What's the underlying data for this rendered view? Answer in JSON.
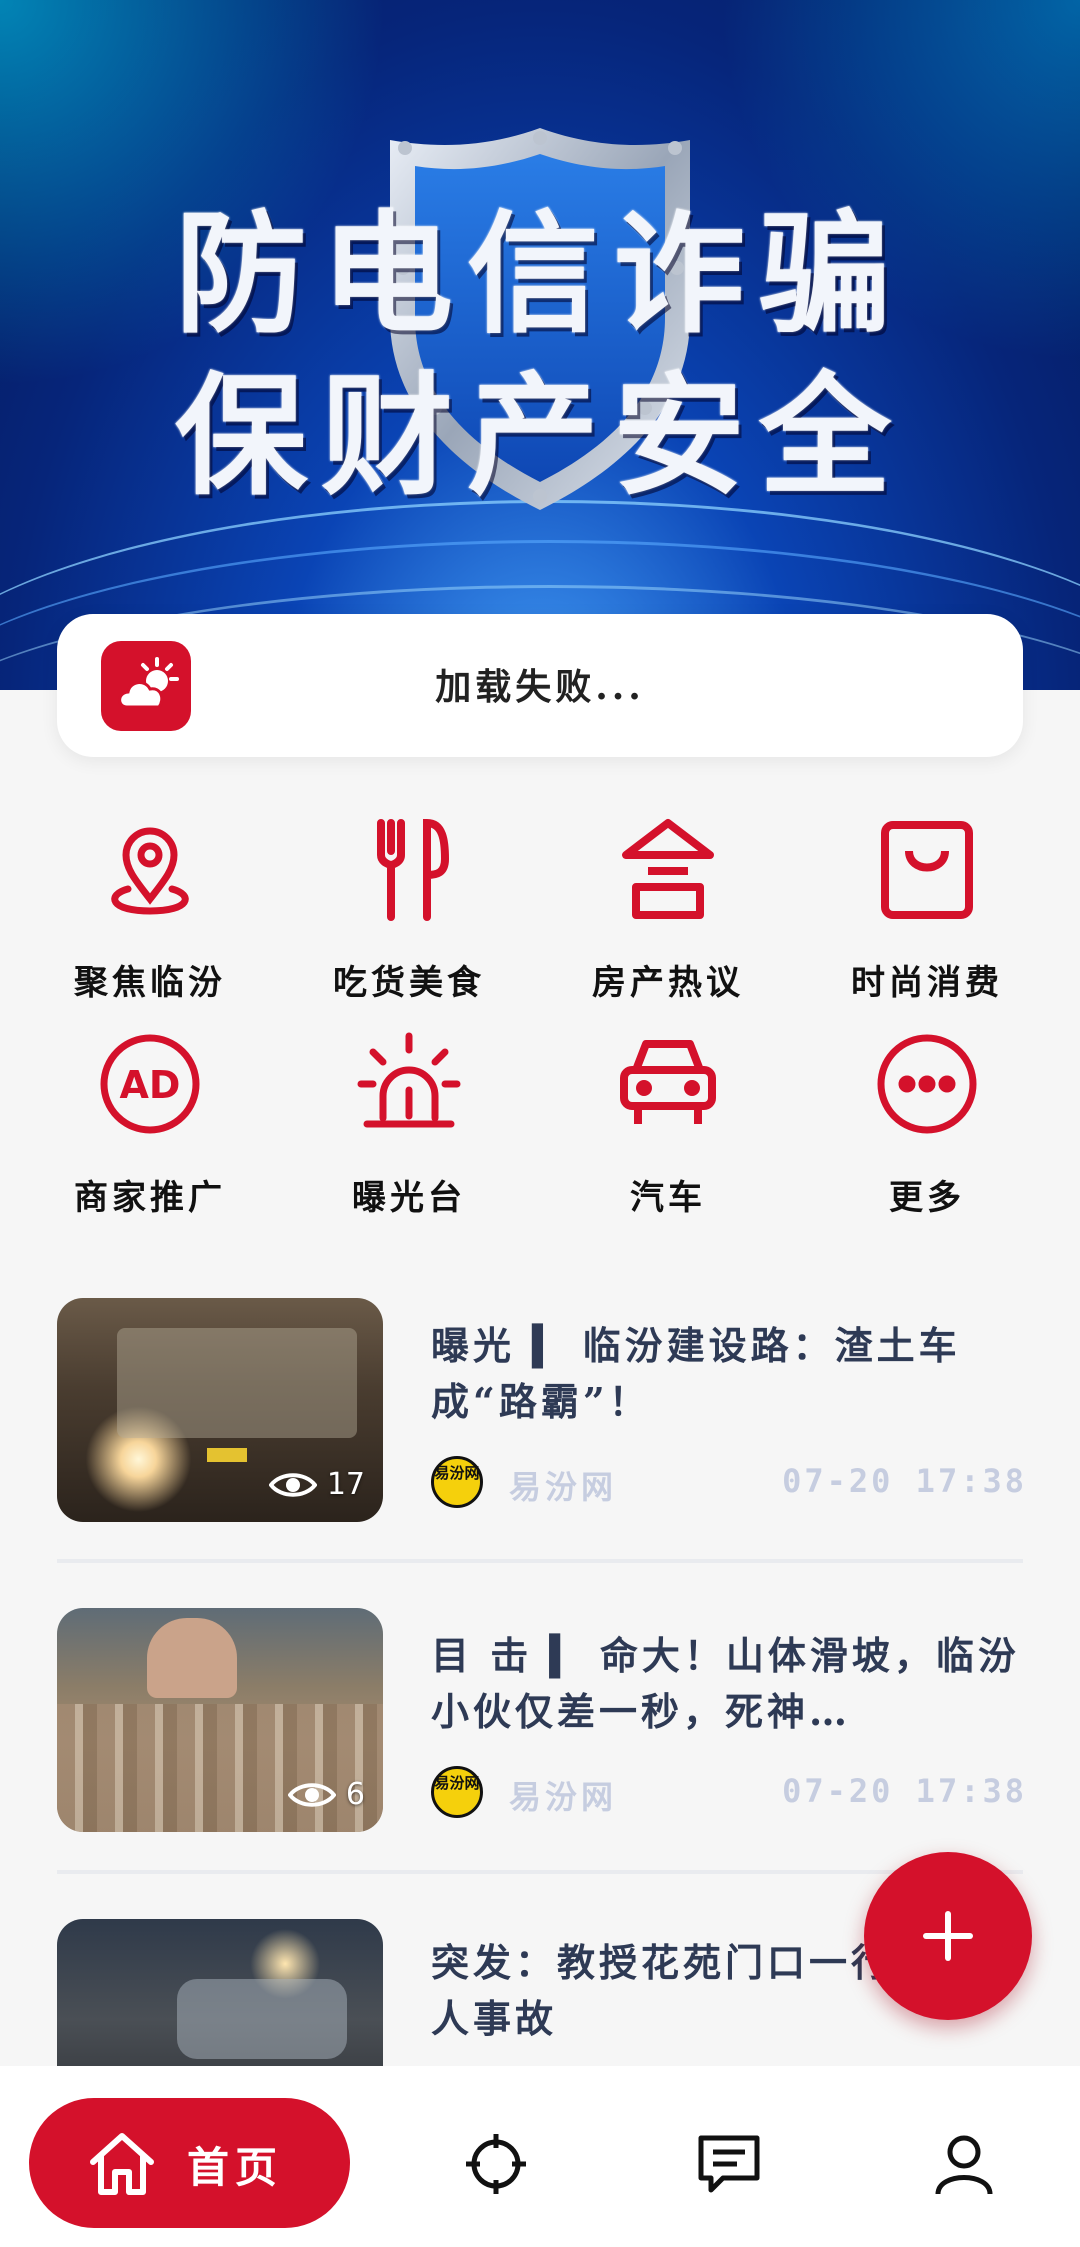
{
  "banner": {
    "line1": "防电信诈骗",
    "line2": "保财产安全"
  },
  "weather": {
    "icon": "weather-cloud-sun-icon",
    "status_text": "加载失败..."
  },
  "categories": [
    {
      "label": "聚焦临汾",
      "icon": "location-pin-icon"
    },
    {
      "label": "吃货美食",
      "icon": "fork-knife-icon"
    },
    {
      "label": "房产热议",
      "icon": "house-icon"
    },
    {
      "label": "时尚消费",
      "icon": "shopping-bag-icon"
    },
    {
      "label": "商家推广",
      "icon": "ad-icon"
    },
    {
      "label": "曝光台",
      "icon": "alarm-light-icon"
    },
    {
      "label": "汽车",
      "icon": "car-icon"
    },
    {
      "label": "更多",
      "icon": "more-icon"
    }
  ],
  "articles": [
    {
      "title": "曝光 ▍ 临汾建设路：渣土车成“路霸”！",
      "views": "17",
      "source_logo": "易汾网",
      "source": "易汾网",
      "time": "07-20 17:38"
    },
    {
      "title": "目 击 ▍ 命大！山体滑坡，临汾小伙仅差一秒，死神…",
      "views": "6",
      "source_logo": "易汾网",
      "source": "易汾网",
      "time": "07-20 17:38"
    },
    {
      "title": "突发：教授花苑门口一行发生撞人事故"
    }
  ],
  "fab": {
    "icon": "plus-icon"
  },
  "bottom_nav": {
    "home_label": "首页",
    "items": [
      "home-icon",
      "discover-icon",
      "messages-icon",
      "profile-icon"
    ]
  },
  "colors": {
    "accent": "#d4112b",
    "title": "#2e3a55",
    "meta": "#c6cde0"
  }
}
